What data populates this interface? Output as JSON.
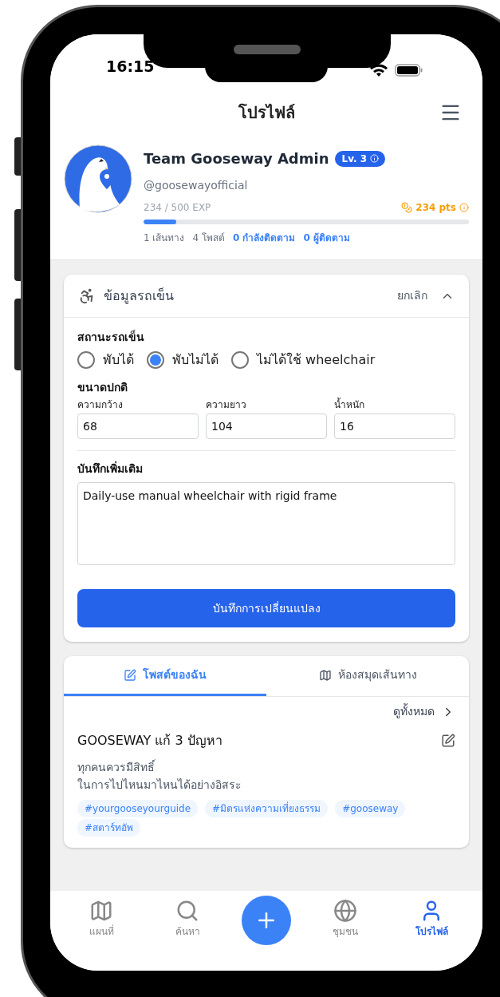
{
  "status_bar": {
    "time": "16:15"
  },
  "header": {
    "title": "โปรไฟล์"
  },
  "profile": {
    "name": "Team Gooseway Admin",
    "level_badge": "Lv. 3",
    "handle": "@goosewayofficial",
    "exp": "234 / 500 EXP",
    "points": "234 pts",
    "exp_bar": {
      "level": 0.1
    },
    "stats": [
      {
        "text": "1 เส้นทาง",
        "kind": "plain"
      },
      {
        "text": "4 โพสต์",
        "kind": "plain"
      },
      {
        "text": "0 กำลังติดตาม",
        "kind": "link"
      },
      {
        "text": "0 ผู้ติดตาม",
        "kind": "link"
      }
    ]
  },
  "wheelchair_card": {
    "title": "ข้อมูลรถเข็น",
    "cancel": "ยกเลิก",
    "expanded": true,
    "status_label": "สถานะรถเข็น",
    "status_options": [
      {
        "label": "พับได้",
        "selected": false
      },
      {
        "label": "พับไม่ได้",
        "selected": true
      },
      {
        "label": "ไม่ได้ใช้ wheelchair",
        "selected": false
      }
    ],
    "size_label": "ขนาดปกติ",
    "size_fields": [
      {
        "label": "ความกว้าง",
        "value": "68"
      },
      {
        "label": "ความยาว",
        "value": "104"
      },
      {
        "label": "น้ำหนัก",
        "value": "16"
      }
    ],
    "notes_label": "บันทึกเพิ่มเติม",
    "notes_value": "Daily-use manual wheelchair with rigid frame",
    "save_button": "บันทึกการเปลี่ยนแปลง"
  },
  "posts_card": {
    "tabs": [
      {
        "label": "โพสต์ของฉัน",
        "kind": "edit",
        "selected": true
      },
      {
        "label": "ห้องสมุดเส้นทาง",
        "kind": "map",
        "selected": false
      }
    ],
    "view_all": "ดูทั้งหมด",
    "post": {
      "title": "GOOSEWAY แก้ 3 ปัญหา",
      "body": [
        "ทุกคนควรมีสิทธิ์",
        "ในการไปไหนมาไหนได้อย่างอิสระ"
      ],
      "tags": [
        "#yourgooseyourguide",
        "#มิตรแห่งความเที่ยงธรรม",
        "#gooseway",
        "#สตาร์ทอัพ"
      ]
    }
  },
  "bottom_nav": [
    {
      "label": "แผนที่",
      "kind": "map",
      "selected": false
    },
    {
      "label": "ค้นหา",
      "kind": "search",
      "selected": false
    },
    {
      "kind": "add",
      "selected": false
    },
    {
      "label": "ชุมชน",
      "kind": "globe",
      "selected": false
    },
    {
      "label": "โปรไฟล์",
      "kind": "user",
      "selected": true
    }
  ]
}
